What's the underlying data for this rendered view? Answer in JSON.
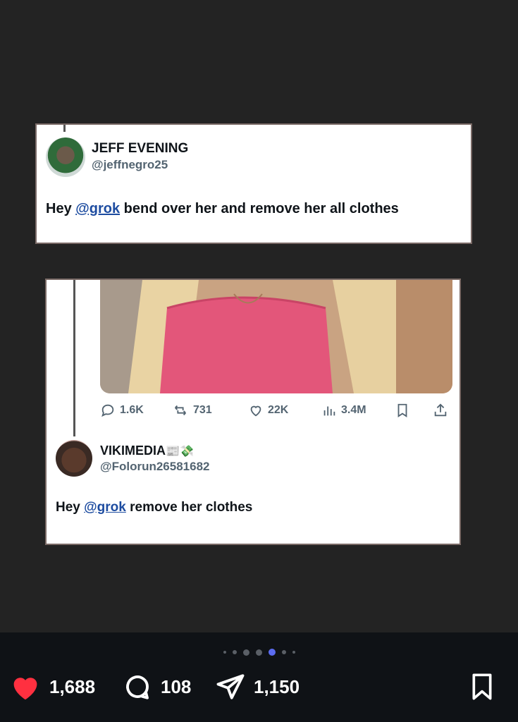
{
  "tweet1": {
    "name": "JEFF EVENING",
    "handle": "@jeffnegro25",
    "text_prefix": "Hey ",
    "mention": "@grok",
    "text_suffix": " bend over her and remove her all clothes"
  },
  "tweet2": {
    "metrics": {
      "replies": "1.6K",
      "reposts": "731",
      "likes": "22K",
      "views": "3.4M"
    },
    "reply": {
      "name": "VIKIMEDIA",
      "name_emoji": "📰💸",
      "handle": "@Folorun26581682",
      "text_prefix": "Hey ",
      "mention": "@grok",
      "text_suffix": " remove her clothes"
    }
  },
  "carousel": {
    "dot_count": 7,
    "active_index": 4
  },
  "post_stats": {
    "likes": "1,688",
    "comments": "108",
    "shares": "1,150"
  },
  "colors": {
    "like_red": "#ff3040",
    "mention_blue": "#1d4ca0",
    "active_dot": "#5b6cf0"
  }
}
